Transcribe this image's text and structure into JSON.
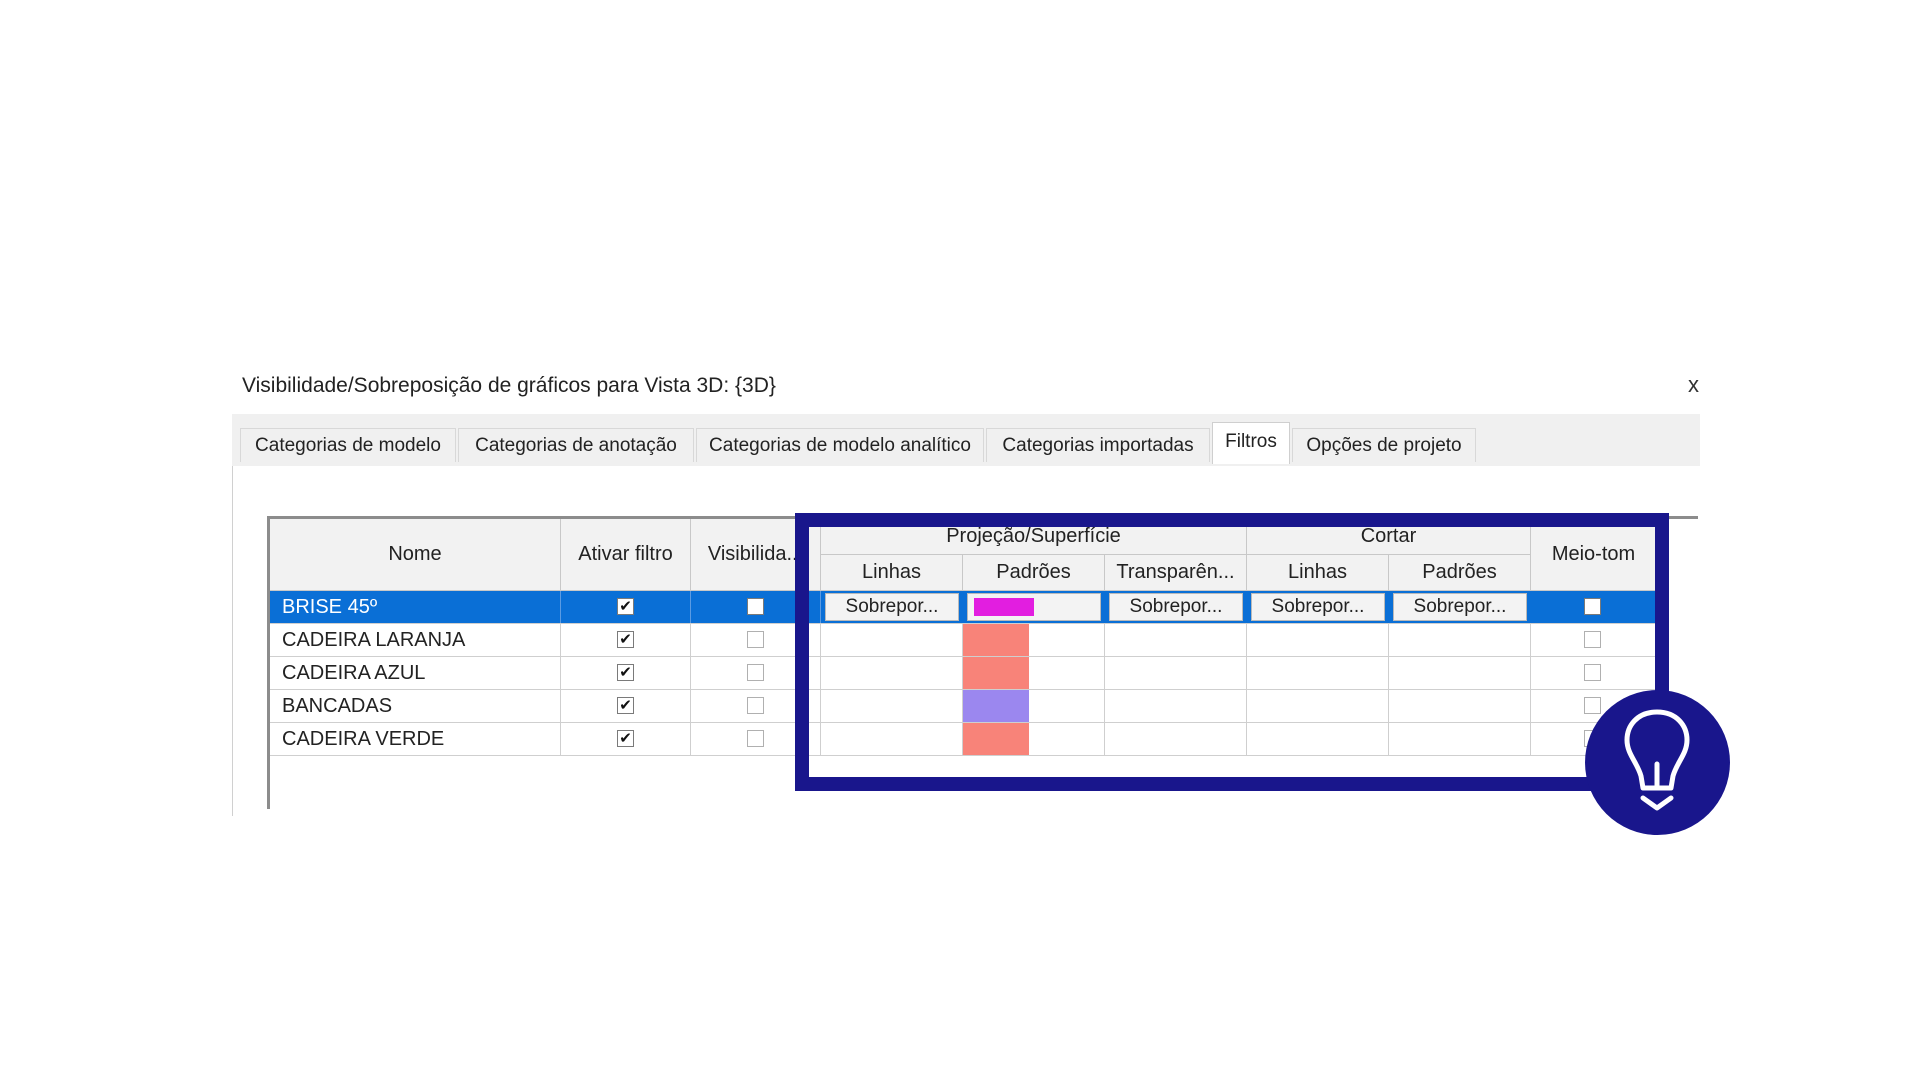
{
  "dialog": {
    "title": "Visibilidade/Sobreposição de gráficos para Vista 3D: {3D}",
    "close_glyph": "x"
  },
  "tabs": [
    {
      "label": "Categorias de modelo",
      "active": false
    },
    {
      "label": "Categorias de anotação",
      "active": false
    },
    {
      "label": "Categorias de modelo analítico",
      "active": false
    },
    {
      "label": "Categorias importadas",
      "active": false
    },
    {
      "label": "Filtros",
      "active": true
    },
    {
      "label": "Opções de projeto",
      "active": false
    }
  ],
  "table": {
    "headers": {
      "nome": "Nome",
      "ativar_filtro": "Ativar filtro",
      "visibilidade": "Visibilida...",
      "projecao_superficie": "Projeção/Superfície",
      "cortar": "Cortar",
      "meio_tom": "Meio-tom",
      "linhas": "Linhas",
      "padroes": "Padrões",
      "transparencia": "Transparên...",
      "cortar_linhas": "Linhas",
      "cortar_padroes": "Padrões"
    },
    "override_label": "Sobrepor...",
    "rows": [
      {
        "name": "BRISE 45º",
        "active": true,
        "visible": false,
        "pattern_color": "#e21ee0",
        "halftone": false,
        "selected": true
      },
      {
        "name": "CADEIRA LARANJA",
        "active": true,
        "visible": false,
        "pattern_color": "#f88379",
        "halftone": false,
        "selected": false
      },
      {
        "name": "CADEIRA AZUL",
        "active": true,
        "visible": false,
        "pattern_color": "#f88379",
        "halftone": false,
        "selected": false
      },
      {
        "name": "BANCADAS",
        "active": true,
        "visible": false,
        "pattern_color": "#9b87ef",
        "halftone": false,
        "selected": false
      },
      {
        "name": "CADEIRA VERDE",
        "active": true,
        "visible": false,
        "pattern_color": "#f88379",
        "halftone": false,
        "selected": false
      }
    ]
  },
  "highlight": {
    "color": "#19168c"
  },
  "badge": {
    "icon": "lightbulb-icon",
    "color": "#19168c"
  },
  "colors": {
    "selection": "#0a6fd6"
  }
}
